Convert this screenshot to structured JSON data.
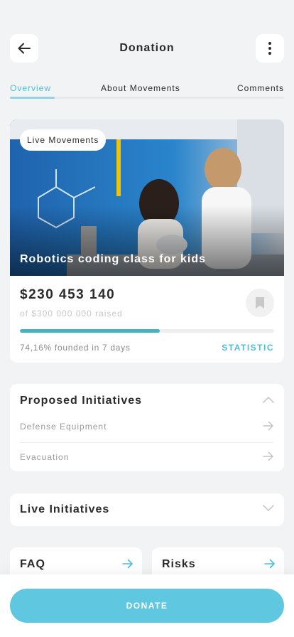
{
  "header": {
    "title": "Donation",
    "back_icon": "arrow-left-icon",
    "more_icon": "more-vertical-icon"
  },
  "tabs": [
    {
      "label": "Overview",
      "active": true
    },
    {
      "label": "About Movements",
      "active": false
    },
    {
      "label": "Comments",
      "active": false
    }
  ],
  "campaign": {
    "badge": "Live Movements",
    "title": "Robotics coding class for kids",
    "amount": "$230 453 140",
    "raised": "of $300 000 000 raised",
    "progress_percent": 55,
    "founded": "74,16% founded in 7 days",
    "statistic_label": "STATISTIC"
  },
  "proposed": {
    "title": "Proposed Initiatives",
    "items": [
      {
        "label": "Defense Equipment"
      },
      {
        "label": "Evacuation"
      }
    ]
  },
  "live": {
    "title": "Live Initiatives"
  },
  "faq": {
    "title": "FAQ"
  },
  "risks": {
    "title": "Risks"
  },
  "footer": {
    "donate_label": "DONATE"
  },
  "colors": {
    "accent": "#4cbed7",
    "progress": "#45b3bd",
    "donate": "#5fc8e0",
    "background": "#f2f3f5"
  }
}
